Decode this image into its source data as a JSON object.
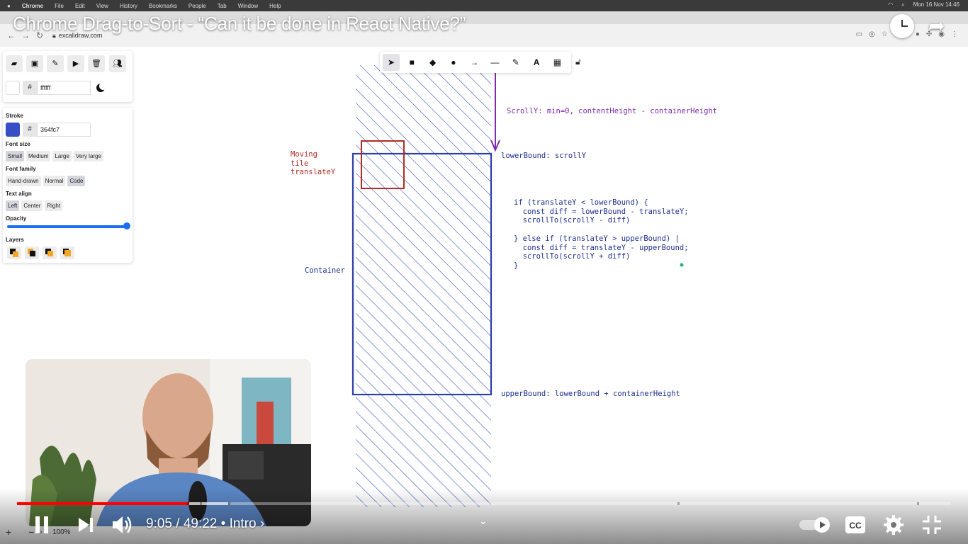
{
  "mac_menubar": {
    "items": [
      "Chrome",
      "File",
      "Edit",
      "View",
      "History",
      "Bookmarks",
      "People",
      "Tab",
      "Window",
      "Help"
    ],
    "clock": "Mon 16 Nov  14:46"
  },
  "browser": {
    "url": "excalidraw.com"
  },
  "video": {
    "title": "Chrome Drag-to-Sort - “Can it be done in React Native?”",
    "current_time": "9:05",
    "duration": "49:22",
    "chapter": "Intro",
    "time_display": "9:05 / 49:22 • Intro ›",
    "progress_fraction": 0.184,
    "buffered_fraction": 0.226
  },
  "excalidraw": {
    "canvas_bg_hex": "ffffff",
    "stroke_hex": "364fc7",
    "stroke_color": "#364fc7",
    "labels": {
      "stroke": "Stroke",
      "font_size": "Font size",
      "font_family": "Font family",
      "text_align": "Text align",
      "opacity": "Opacity",
      "layers": "Layers"
    },
    "font_sizes": [
      "Small",
      "Medium",
      "Large",
      "Very large"
    ],
    "font_families": [
      "Hand-drawn",
      "Normal",
      "Code"
    ],
    "text_aligns": [
      "Left",
      "Center",
      "Right"
    ],
    "opacity_value": 1.0,
    "zoom": "100%"
  },
  "drawing": {
    "scroll_label": "ScrollY: min=0, contentHeight - containerHeight",
    "lower_bound": "lowerBound: scrollY",
    "upper_bound": "upperBound: lowerBound + containerHeight",
    "moving_tile": [
      "Moving",
      "tile",
      "translateY"
    ],
    "container": "Container",
    "code_lines": [
      "if (translateY < lowerBound) {",
      "  const diff = lowerBound - translateY;",
      "  scrollTo(scrollY - diff)",
      "",
      "} else if (translateY > upperBound) |",
      "  const diff = translateY - upperBound;",
      "  scrollTo(scrollY + diff)",
      "}"
    ]
  }
}
